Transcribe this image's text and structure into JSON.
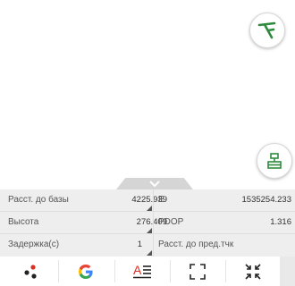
{
  "colors": {
    "accent_green": "#2e8b3e",
    "google_red": "#ea4335",
    "google_blue": "#4285f4",
    "google_yellow": "#fbbc05",
    "google_green": "#34a853"
  },
  "fabs": [
    {
      "icon": "survey-pole-icon"
    },
    {
      "icon": "stakeout-icon"
    }
  ],
  "panel": {
    "rows": [
      {
        "left_label": "Расст. до базы",
        "left_value": "4225.939",
        "right_label": "E",
        "right_value": "1535254.233"
      },
      {
        "left_label": "Высота",
        "left_value": "276.409",
        "right_label": "PDOP",
        "right_value": "1.316"
      },
      {
        "left_label": "Задержка(с)",
        "left_value": "1",
        "right_label": "Расст. до пред.тчк",
        "right_value": ""
      }
    ]
  },
  "toolbar": {
    "items": [
      {
        "icon": "points-icon"
      },
      {
        "icon": "google-icon",
        "glyph": "G"
      },
      {
        "icon": "text-format-icon",
        "glyph": "A"
      },
      {
        "icon": "fullscreen-icon"
      },
      {
        "icon": "collapse-icon"
      }
    ]
  }
}
